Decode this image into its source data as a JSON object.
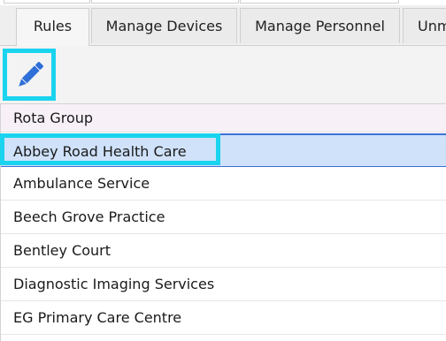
{
  "tabs": [
    {
      "label": "Rules",
      "active": true
    },
    {
      "label": "Manage Devices",
      "active": false
    },
    {
      "label": "Manage Personnel",
      "active": false
    },
    {
      "label": "Unm",
      "active": false
    }
  ],
  "toolbar": {
    "edit_icon": "pencil-icon",
    "highlight_color": "#1ad3ee"
  },
  "list": {
    "header": "Rota Group",
    "items": [
      "Abbey Road Health Care",
      "Ambulance Service",
      "Beech Grove Practice",
      "Bentley Court",
      "Diagnostic Imaging Services",
      "EG Primary Care Centre"
    ],
    "selected_index": 0,
    "selection_color": "#cfe2f9"
  }
}
